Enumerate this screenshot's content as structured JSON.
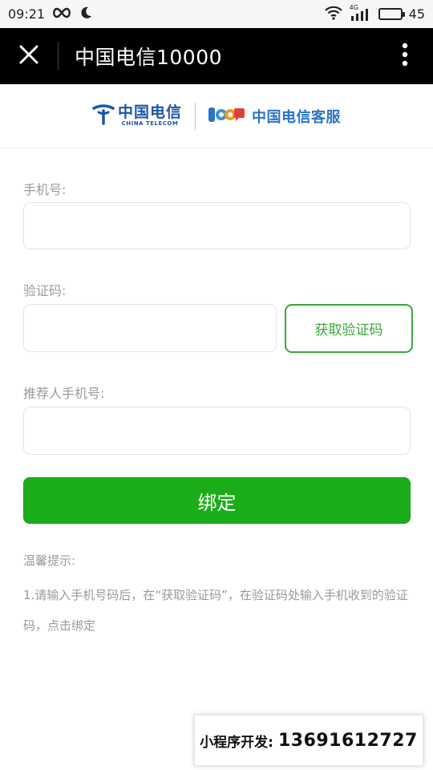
{
  "status_bar": {
    "time": "09:21",
    "network_type": "4G",
    "battery_level": "45"
  },
  "title_bar": {
    "title": "中国电信10000"
  },
  "logo": {
    "brand_cn": "中国电信",
    "brand_en": "CHINA TELECOM",
    "service_name": "中国电信客服"
  },
  "form": {
    "phone_label": "手机号:",
    "phone_value": "",
    "code_label": "验证码:",
    "code_value": "",
    "get_code_button": "获取验证码",
    "referrer_label": "推荐人手机号:",
    "referrer_value": "",
    "bind_button": "绑定"
  },
  "tips": {
    "title": "温馨提示:",
    "body": "1.请输入手机号码后，在“获取验证码”，在验证码处输入手机收到的验证码，点击绑定"
  },
  "promo": {
    "label": "小程序开发:",
    "phone": "13691612727"
  },
  "colors": {
    "accent_green": "#1aad19",
    "outline_green": "#39a736",
    "telecom_blue": "#1b57a6"
  },
  "icons": {
    "close": "close-icon",
    "more": "more-vertical-icon",
    "wifi": "wifi-icon",
    "signal": "signal-icon",
    "battery": "battery-icon",
    "infinity": "infinity-icon",
    "moon": "moon-icon"
  }
}
